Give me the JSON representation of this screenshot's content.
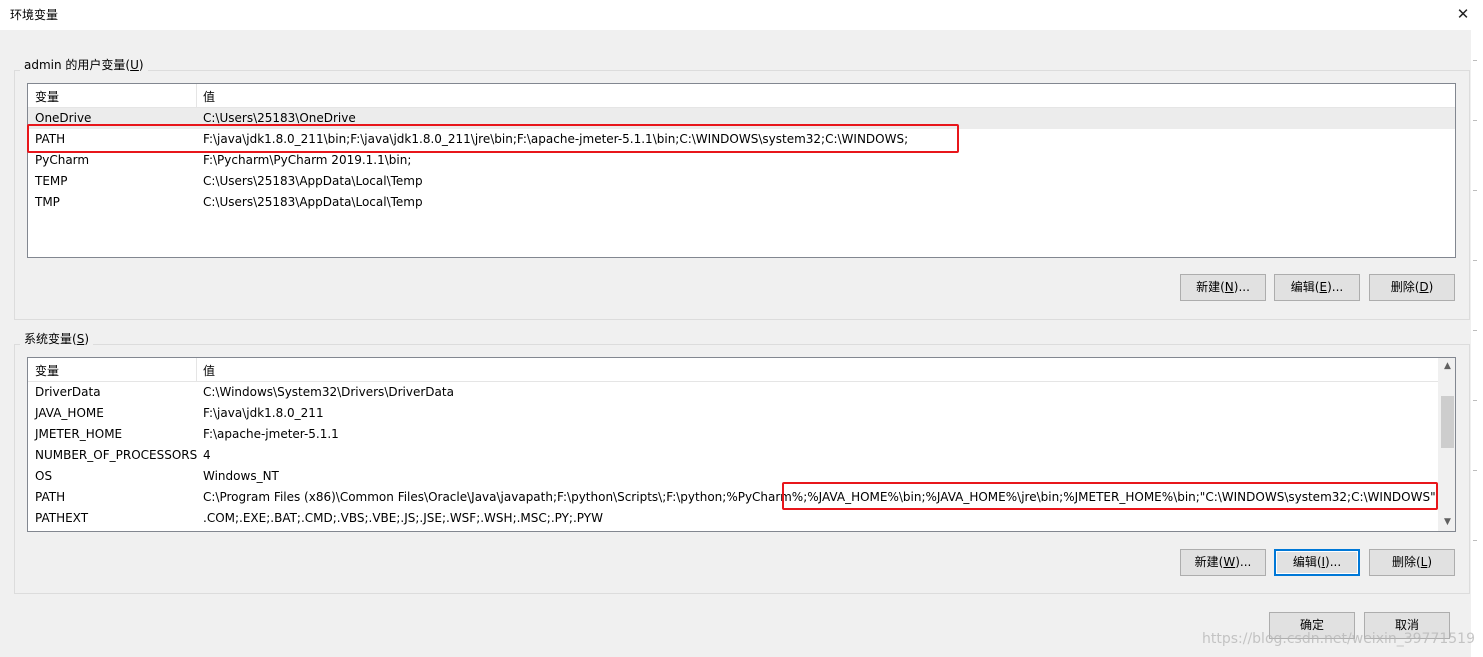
{
  "window": {
    "title": "环境变量",
    "close_glyph": "✕"
  },
  "user_vars": {
    "group_label_pre": "admin 的用户变量(",
    "group_label_key": "U",
    "group_label_post": ")",
    "header": {
      "var": "变量",
      "val": "值"
    },
    "rows": [
      {
        "var": "OneDrive",
        "val": "C:\\Users\\25183\\OneDrive"
      },
      {
        "var": "PATH",
        "val": "F:\\java\\jdk1.8.0_211\\bin;F:\\java\\jdk1.8.0_211\\jre\\bin;F:\\apache-jmeter-5.1.1\\bin;C:\\WINDOWS\\system32;C:\\WINDOWS;"
      },
      {
        "var": "PyCharm",
        "val": "F:\\Pycharm\\PyCharm 2019.1.1\\bin;"
      },
      {
        "var": "TEMP",
        "val": "C:\\Users\\25183\\AppData\\Local\\Temp"
      },
      {
        "var": "TMP",
        "val": "C:\\Users\\25183\\AppData\\Local\\Temp"
      }
    ],
    "buttons": {
      "new": {
        "pre": "新建(",
        "key": "N",
        "post": ")..."
      },
      "edit": {
        "pre": "编辑(",
        "key": "E",
        "post": ")..."
      },
      "delete": {
        "pre": "删除(",
        "key": "D",
        "post": ")"
      }
    }
  },
  "sys_vars": {
    "group_label_pre": "系统变量(",
    "group_label_key": "S",
    "group_label_post": ")",
    "header": {
      "var": "变量",
      "val": "值"
    },
    "rows": [
      {
        "var": "DriverData",
        "val": "C:\\Windows\\System32\\Drivers\\DriverData"
      },
      {
        "var": "JAVA_HOME",
        "val": "F:\\java\\jdk1.8.0_211"
      },
      {
        "var": "JMETER_HOME",
        "val": "F:\\apache-jmeter-5.1.1"
      },
      {
        "var": "NUMBER_OF_PROCESSORS",
        "val": "4"
      },
      {
        "var": "OS",
        "val": "Windows_NT"
      },
      {
        "var": "PATH",
        "val": "C:\\Program Files (x86)\\Common Files\\Oracle\\Java\\javapath;F:\\python\\Scripts\\;F:\\python;%PyCharm%;%JAVA_HOME%\\bin;%JAVA_HOME%\\jre\\bin;%JMETER_HOME%\\bin;\"C:\\WINDOWS\\system32;C:\\WINDOWS\";"
      },
      {
        "var": "PATHEXT",
        "val": ".COM;.EXE;.BAT;.CMD;.VBS;.VBE;.JS;.JSE;.WSF;.WSH;.MSC;.PY;.PYW"
      }
    ],
    "scroll_up_glyph": "▲",
    "scroll_down_glyph": "▼",
    "buttons": {
      "new": {
        "pre": "新建(",
        "key": "W",
        "post": ")..."
      },
      "edit": {
        "pre": "编辑(",
        "key": "I",
        "post": ")..."
      },
      "delete": {
        "pre": "删除(",
        "key": "L",
        "post": ")"
      }
    }
  },
  "dialog_buttons": {
    "ok": "确定",
    "cancel": "取消"
  },
  "watermark": "https://blog.csdn.net/weixin_39771519"
}
